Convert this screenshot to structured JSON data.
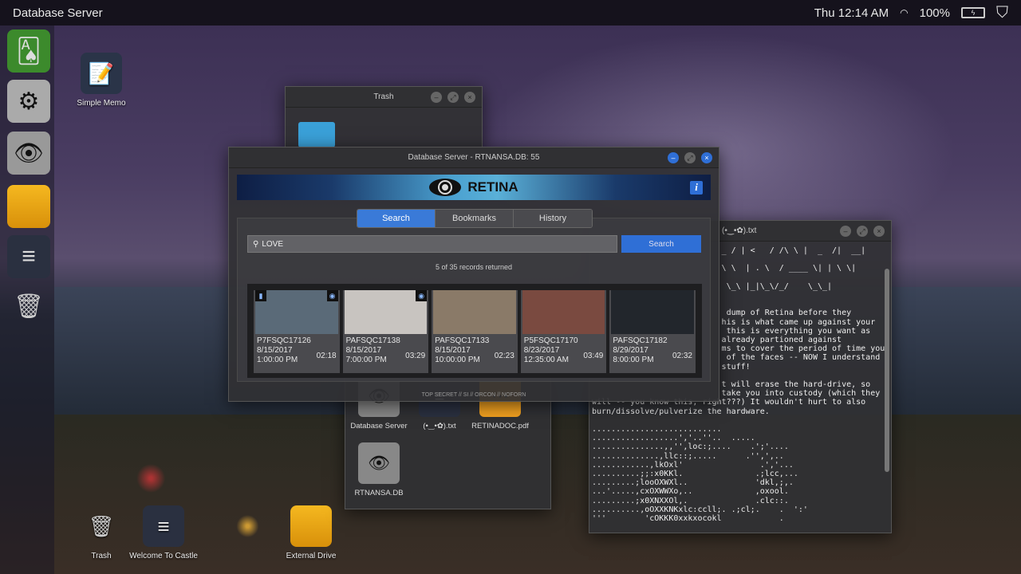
{
  "topbar": {
    "title": "Database Server",
    "clock": "Thu 12:14 AM",
    "battery": "100%",
    "icons": [
      "wifi-icon",
      "battery-icon",
      "castle-shield-icon"
    ]
  },
  "dock": {
    "items": [
      "solitaire",
      "settings",
      "retina-eye",
      "external-drive",
      "notes",
      "trash"
    ]
  },
  "desktop": {
    "icons": [
      {
        "label": "Simple Memo"
      },
      {
        "label": "Trash"
      },
      {
        "label": "Welcome To Castle"
      },
      {
        "label": "External Drive"
      }
    ]
  },
  "trash_window": {
    "title": "Trash"
  },
  "main_window": {
    "title": "Database Server - RTNANSA.DB: 55",
    "brand": "RETINA",
    "info_label": "i",
    "tabs": [
      {
        "label": "Search",
        "active": true
      },
      {
        "label": "Bookmarks"
      },
      {
        "label": "History"
      }
    ],
    "search": {
      "value": "LOVE",
      "button": "Search"
    },
    "count": "5 of 35 records returned",
    "results": [
      {
        "id": "P7FSQC17126",
        "date": "8/15/2017",
        "time": "1:00:00 PM",
        "duration": "02:18",
        "bookmarked": true,
        "viewed": true,
        "color": "#5a6a78"
      },
      {
        "id": "PAFSQC17138",
        "date": "8/15/2017",
        "time": "7:00:00 PM",
        "duration": "03:29",
        "bookmarked": false,
        "viewed": true,
        "color": "#c8c4c0"
      },
      {
        "id": "PAFSQC17133",
        "date": "8/15/2017",
        "time": "10:00:00 PM",
        "duration": "02:23",
        "bookmarked": false,
        "viewed": false,
        "color": "#8a7a68"
      },
      {
        "id": "P5FSQC17170",
        "date": "8/23/2017",
        "time": "12:35:00 AM",
        "duration": "03:49",
        "bookmarked": false,
        "viewed": false,
        "color": "#7a4a40"
      },
      {
        "id": "PAFSQC17182",
        "date": "8/29/2017",
        "time": "8:00:00 PM",
        "duration": "02:32",
        "bookmarked": false,
        "viewed": false,
        "color": "#22262c"
      }
    ],
    "footer": "TOP SECRET // SI // ORCON // NOFORN"
  },
  "text_window": {
    "title": "(•‿•✿).txt",
    "content": "                           _ / | <   / /\\ \\ |  _  /|  __|\n\n                           \\ \\  | . \\  / ____ \\| | \\ \\|\n\n                            \\_\\ |_|\\_\\/_/    \\_\\_|\n\n\n                            dump of Retina before they\n                           his is what came up against your\n                            this is everything you want as\n                           already partioned against\n                           ms to cover the period of time you\n                            of the faces -- NOW I understand\n                           stuff!\n\n                           t will erase the hard-drive, so\n                           take you into custody (which they\nwill -- you know this, right???) It wouldn't hurt to also\nburn/dissolve/pulverize the hardware.\n\n...........................\n..................','..''..  .....\n...............,,'',loc:;....    .';'....\n..............,llc::;.....      .'',',..\n............,lkOxl'                .','...\n..........;;:x0KKl.               .;lcc,...\n.........;looOXWXl..              'dkl,;,.\n...'.....,cxOXWWXo,..             ,oxool.\n.........;x0XNXXOl,.              .clc::.\n..........,oOXXKNKxlc:ccll;. .;cl;.    .  ':'\n'''        'cOKKK0xxkxocokl            ."
  },
  "file_window": {
    "items": [
      {
        "label": "Database Server"
      },
      {
        "label": "(•‿•✿).txt"
      },
      {
        "label": "RETINADOC.pdf"
      },
      {
        "label": "RTNANSA.DB"
      }
    ]
  }
}
